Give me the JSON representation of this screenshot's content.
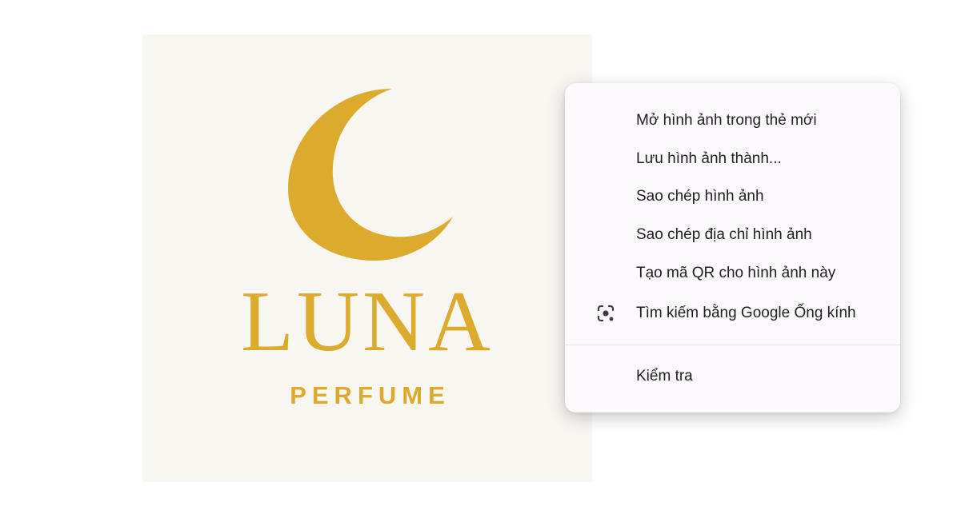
{
  "image": {
    "brand_name": "LUNA",
    "brand_tagline": "PERFUME",
    "accent_color": "#dcab2e",
    "background_color": "#f8f6f1"
  },
  "context_menu": {
    "items": [
      {
        "label": "Mở hình ảnh trong thẻ mới"
      },
      {
        "label": "Lưu hình ảnh thành..."
      },
      {
        "label": "Sao chép hình ảnh"
      },
      {
        "label": "Sao chép địa chỉ hình ảnh"
      },
      {
        "label": "Tạo mã QR cho hình ảnh này"
      },
      {
        "label": "Tìm kiếm bằng Google Ống kính",
        "icon": "google-lens-icon"
      },
      {
        "label": "Kiểm tra"
      }
    ]
  }
}
